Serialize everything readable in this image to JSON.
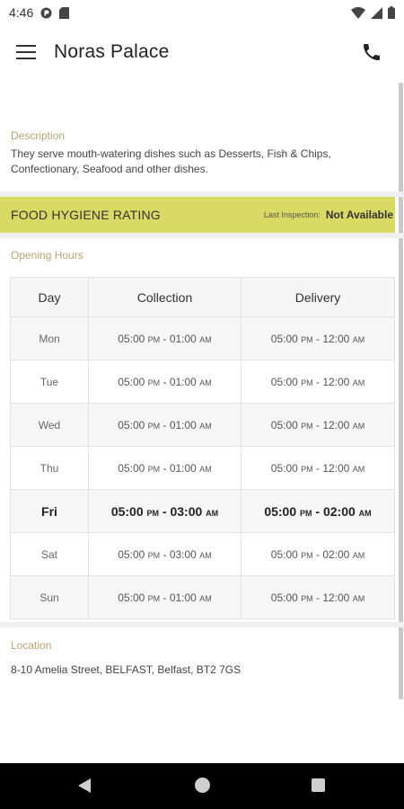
{
  "status_bar": {
    "time": "4:46",
    "icons": [
      "app-notification-icon",
      "sd-card-icon",
      "wifi-icon",
      "signal-icon",
      "battery-icon"
    ]
  },
  "header": {
    "title": "Noras Palace",
    "menu_icon": "hamburger-menu-icon",
    "call_icon": "phone-icon"
  },
  "description": {
    "label": "Description",
    "text": "They serve mouth-watering dishes such as Desserts, Fish & Chips, Confectionary, Seafood and other dishes."
  },
  "hygiene": {
    "title": "FOOD HYGIENE RATING",
    "last_inspection_label": "Last Inspection:",
    "last_inspection_value": "Not Available",
    "color": "#d9da63"
  },
  "opening_hours": {
    "label": "Opening Hours",
    "columns": [
      "Day",
      "Collection",
      "Delivery"
    ],
    "rows": [
      {
        "day": "Mon",
        "c_from": "05:00",
        "c_from_ap": "PM",
        "c_to": "01:00",
        "c_to_ap": "AM",
        "d_from": "05:00",
        "d_from_ap": "PM",
        "d_to": "12:00",
        "d_to_ap": "AM"
      },
      {
        "day": "Tue",
        "c_from": "05:00",
        "c_from_ap": "PM",
        "c_to": "01:00",
        "c_to_ap": "AM",
        "d_from": "05:00",
        "d_from_ap": "PM",
        "d_to": "12:00",
        "d_to_ap": "AM"
      },
      {
        "day": "Wed",
        "c_from": "05:00",
        "c_from_ap": "PM",
        "c_to": "01:00",
        "c_to_ap": "AM",
        "d_from": "05:00",
        "d_from_ap": "PM",
        "d_to": "12:00",
        "d_to_ap": "AM"
      },
      {
        "day": "Thu",
        "c_from": "05:00",
        "c_from_ap": "PM",
        "c_to": "01:00",
        "c_to_ap": "AM",
        "d_from": "05:00",
        "d_from_ap": "PM",
        "d_to": "12:00",
        "d_to_ap": "AM"
      },
      {
        "day": "Fri",
        "c_from": "05:00",
        "c_from_ap": "PM",
        "c_to": "03:00",
        "c_to_ap": "AM",
        "d_from": "05:00",
        "d_from_ap": "PM",
        "d_to": "02:00",
        "d_to_ap": "AM"
      },
      {
        "day": "Sat",
        "c_from": "05:00",
        "c_from_ap": "PM",
        "c_to": "03:00",
        "c_to_ap": "AM",
        "d_from": "05:00",
        "d_from_ap": "PM",
        "d_to": "02:00",
        "d_to_ap": "AM"
      },
      {
        "day": "Sun",
        "c_from": "05:00",
        "c_from_ap": "PM",
        "c_to": "01:00",
        "c_to_ap": "AM",
        "d_from": "05:00",
        "d_from_ap": "PM",
        "d_to": "12:00",
        "d_to_ap": "AM"
      }
    ],
    "highlighted_day": "Fri"
  },
  "location": {
    "label": "Location",
    "address": "8-10 Amelia Street, BELFAST, Belfast, BT2 7GS"
  },
  "nav_bar": {
    "icons": [
      "back-icon",
      "home-icon",
      "recent-apps-icon"
    ]
  }
}
